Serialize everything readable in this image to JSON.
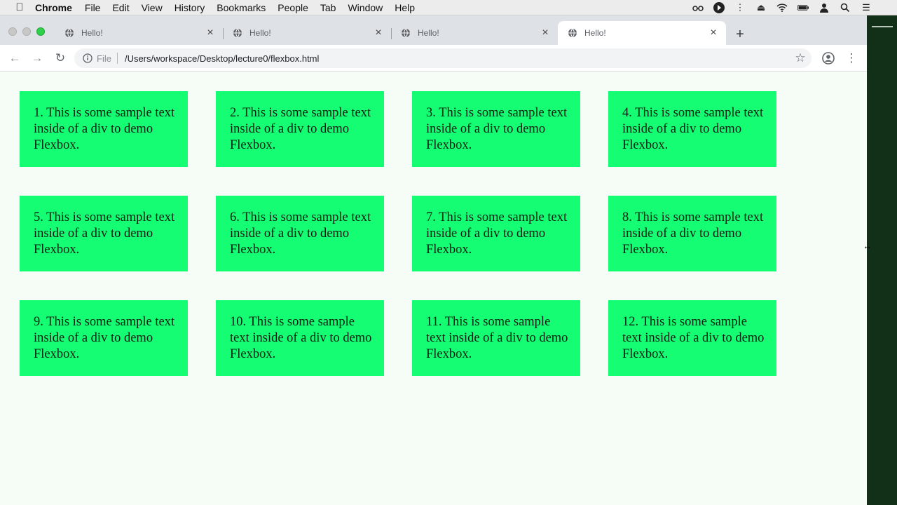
{
  "menubar": {
    "app_name": "Chrome",
    "menus": [
      "File",
      "Edit",
      "View",
      "History",
      "Bookmarks",
      "People",
      "Tab",
      "Window",
      "Help"
    ]
  },
  "tabs": [
    {
      "title": "Hello!",
      "active": false
    },
    {
      "title": "Hello!",
      "active": false
    },
    {
      "title": "Hello!",
      "active": false
    },
    {
      "title": "Hello!",
      "active": true
    }
  ],
  "address_bar": {
    "scheme_label": "File",
    "path": "/Users/workspace/Desktop/lecture0/flexbox.html"
  },
  "page": {
    "box_color": "#15fd72",
    "boxes": [
      "1. This is some sample text inside of a div to demo Flexbox.",
      "2. This is some sample text inside of a div to demo Flexbox.",
      "3. This is some sample text inside of a div to demo Flexbox.",
      "4. This is some sample text inside of a div to demo Flexbox.",
      "5. This is some sample text inside of a div to demo Flexbox.",
      "6. This is some sample text inside of a div to demo Flexbox.",
      "7. This is some sample text inside of a div to demo Flexbox.",
      "8. This is some sample text inside of a div to demo Flexbox.",
      "9. This is some sample text inside of a div to demo Flexbox.",
      "10. This is some sample text inside of a div to demo Flexbox.",
      "11. This is some sample text inside of a div to demo Flexbox.",
      "12. This is some sample text inside of a div to demo Flexbox."
    ]
  }
}
